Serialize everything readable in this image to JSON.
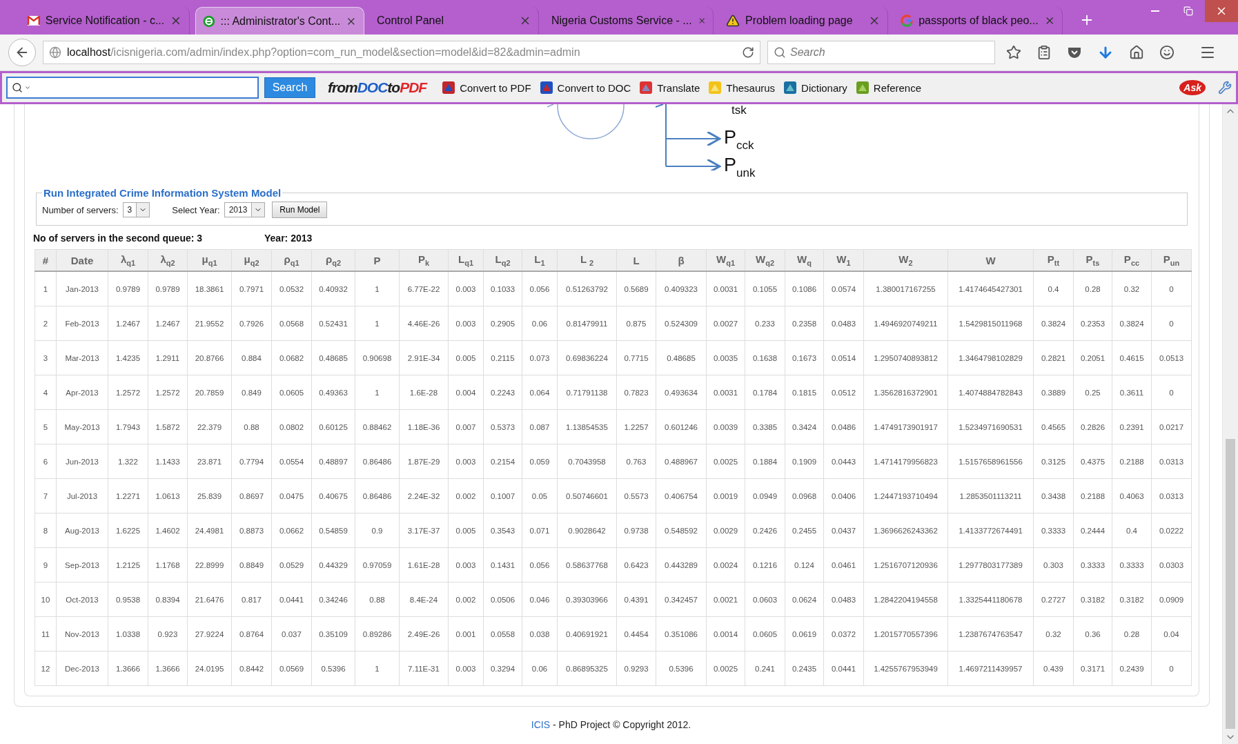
{
  "browser": {
    "tabs": [
      {
        "title": "Service Notification - c...",
        "selected": false
      },
      {
        "title": "::: Administrator's Cont...",
        "selected": true
      },
      {
        "title": "Control Panel",
        "selected": false
      },
      {
        "title": "Nigeria Customs Service - ...",
        "selected": false
      },
      {
        "title": "Problem loading page",
        "selected": false
      },
      {
        "title": "passports of black peo...",
        "selected": false
      }
    ],
    "url_host": "localhost",
    "url_path": "/icisnigeria.com/admin/index.php?option=com_run_model&section=model&id=82&admin=admin",
    "search_placeholder": "Search"
  },
  "toolbar": {
    "search_button": "Search",
    "logo": [
      "from",
      "DOC",
      "to",
      "PDF"
    ],
    "items": [
      "Convert to PDF",
      "Convert to DOC",
      "Translate",
      "Thesaurus",
      "Dictionary",
      "Reference"
    ],
    "ask_logo": "Ask"
  },
  "diagram": {
    "labels": [
      "$_{tsk}$",
      "P$_{cck}$",
      "P$_{unk}$"
    ]
  },
  "model_form": {
    "legend": "Run Integrated Crime Information System Model",
    "servers_label": "Number of servers:",
    "servers_value": "3",
    "year_label": "Select Year:",
    "year_value": "2013",
    "run_button": "Run Model"
  },
  "summary": {
    "servers_text": "No of servers in the second queue: 3",
    "year_text": "Year: 2013"
  },
  "table": {
    "columns": [
      "#",
      "Date",
      "λ$_{q1}$",
      "λ$_{q2}$",
      "μ$_{q1}$",
      "μ$_{q2}$",
      "ρ$_{q1}$",
      "ρ$_{q2}$",
      "P",
      "P$_{k}$",
      "L$_{q1}$",
      "L$_{q2}$",
      "L$_{1}$",
      "L $_{2}$",
      "L",
      "β",
      "W$_{q1}$",
      "W$_{q2}$",
      "W$_{q}$",
      "W$_{1}$",
      "W$_{2}$",
      "W",
      "P$_{tt}$",
      "P$_{ts}$",
      "P$_{cc}$",
      "P$_{un}$"
    ],
    "rows": [
      [
        "1",
        "Jan-2013",
        "0.9789",
        "0.9789",
        "18.3861",
        "0.7971",
        "0.0532",
        "0.40932",
        "1",
        "6.77E-22",
        "0.003",
        "0.1033",
        "0.056",
        "0.51263792",
        "0.5689",
        "0.409323",
        "0.0031",
        "0.1055",
        "0.1086",
        "0.0574",
        "1.380017167255",
        "1.4174645427301",
        "0.4",
        "0.28",
        "0.32",
        "0"
      ],
      [
        "2",
        "Feb-2013",
        "1.2467",
        "1.2467",
        "21.9552",
        "0.7926",
        "0.0568",
        "0.52431",
        "1",
        "4.46E-26",
        "0.003",
        "0.2905",
        "0.06",
        "0.81479911",
        "0.875",
        "0.524309",
        "0.0027",
        "0.233",
        "0.2358",
        "0.0483",
        "1.4946920749211",
        "1.5429815011968",
        "0.3824",
        "0.2353",
        "0.3824",
        "0"
      ],
      [
        "3",
        "Mar-2013",
        "1.4235",
        "1.2911",
        "20.8766",
        "0.884",
        "0.0682",
        "0.48685",
        "0.90698",
        "2.91E-34",
        "0.005",
        "0.2115",
        "0.073",
        "0.69836224",
        "0.7715",
        "0.48685",
        "0.0035",
        "0.1638",
        "0.1673",
        "0.0514",
        "1.2950740893812",
        "1.3464798102829",
        "0.2821",
        "0.2051",
        "0.4615",
        "0.0513"
      ],
      [
        "4",
        "Apr-2013",
        "1.2572",
        "1.2572",
        "20.7859",
        "0.849",
        "0.0605",
        "0.49363",
        "1",
        "1.6E-28",
        "0.004",
        "0.2243",
        "0.064",
        "0.71791138",
        "0.7823",
        "0.493634",
        "0.0031",
        "0.1784",
        "0.1815",
        "0.0512",
        "1.3562816372901",
        "1.4074884782843",
        "0.3889",
        "0.25",
        "0.3611",
        "0"
      ],
      [
        "5",
        "May-2013",
        "1.7943",
        "1.5872",
        "22.379",
        "0.88",
        "0.0802",
        "0.60125",
        "0.88462",
        "1.18E-36",
        "0.007",
        "0.5373",
        "0.087",
        "1.13854535",
        "1.2257",
        "0.601246",
        "0.0039",
        "0.3385",
        "0.3424",
        "0.0486",
        "1.4749173901917",
        "1.5234971690531",
        "0.4565",
        "0.2826",
        "0.2391",
        "0.0217"
      ],
      [
        "6",
        "Jun-2013",
        "1.322",
        "1.1433",
        "23.871",
        "0.7794",
        "0.0554",
        "0.48897",
        "0.86486",
        "1.87E-29",
        "0.003",
        "0.2154",
        "0.059",
        "0.7043958",
        "0.763",
        "0.488967",
        "0.0025",
        "0.1884",
        "0.1909",
        "0.0443",
        "1.4714179956823",
        "1.5157658961556",
        "0.3125",
        "0.4375",
        "0.2188",
        "0.0313"
      ],
      [
        "7",
        "Jul-2013",
        "1.2271",
        "1.0613",
        "25.839",
        "0.8697",
        "0.0475",
        "0.40675",
        "0.86486",
        "2.24E-32",
        "0.002",
        "0.1007",
        "0.05",
        "0.50746601",
        "0.5573",
        "0.406754",
        "0.0019",
        "0.0949",
        "0.0968",
        "0.0406",
        "1.2447193710494",
        "1.2853501113211",
        "0.3438",
        "0.2188",
        "0.4063",
        "0.0313"
      ],
      [
        "8",
        "Aug-2013",
        "1.6225",
        "1.4602",
        "24.4981",
        "0.8873",
        "0.0662",
        "0.54859",
        "0.9",
        "3.17E-37",
        "0.005",
        "0.3543",
        "0.071",
        "0.9028642",
        "0.9738",
        "0.548592",
        "0.0029",
        "0.2426",
        "0.2455",
        "0.0437",
        "1.3696626243362",
        "1.4133772674491",
        "0.3333",
        "0.2444",
        "0.4",
        "0.0222"
      ],
      [
        "9",
        "Sep-2013",
        "1.2125",
        "1.1768",
        "22.8999",
        "0.8849",
        "0.0529",
        "0.44329",
        "0.97059",
        "1.61E-28",
        "0.003",
        "0.1431",
        "0.056",
        "0.58637768",
        "0.6423",
        "0.443289",
        "0.0024",
        "0.1216",
        "0.124",
        "0.0461",
        "1.2516707120936",
        "1.2977803177389",
        "0.303",
        "0.3333",
        "0.3333",
        "0.0303"
      ],
      [
        "10",
        "Oct-2013",
        "0.9538",
        "0.8394",
        "21.6476",
        "0.817",
        "0.0441",
        "0.34246",
        "0.88",
        "8.4E-24",
        "0.002",
        "0.0506",
        "0.046",
        "0.39303966",
        "0.4391",
        "0.342457",
        "0.0021",
        "0.0603",
        "0.0624",
        "0.0483",
        "1.2842204194558",
        "1.3325441180678",
        "0.2727",
        "0.3182",
        "0.3182",
        "0.0909"
      ],
      [
        "11",
        "Nov-2013",
        "1.0338",
        "0.923",
        "27.9224",
        "0.8764",
        "0.037",
        "0.35109",
        "0.89286",
        "2.49E-26",
        "0.001",
        "0.0558",
        "0.038",
        "0.40691921",
        "0.4454",
        "0.351086",
        "0.0014",
        "0.0605",
        "0.0619",
        "0.0372",
        "1.2015770557396",
        "1.2387674763547",
        "0.32",
        "0.36",
        "0.28",
        "0.04"
      ],
      [
        "12",
        "Dec-2013",
        "1.3666",
        "1.3666",
        "24.0195",
        "0.8442",
        "0.0569",
        "0.5396",
        "1",
        "7.11E-31",
        "0.003",
        "0.3294",
        "0.06",
        "0.86895325",
        "0.9293",
        "0.5396",
        "0.0025",
        "0.241",
        "0.2435",
        "0.0441",
        "1.4255767953949",
        "1.4697211439957",
        "0.439",
        "0.3171",
        "0.2439",
        "0"
      ]
    ]
  },
  "footer": {
    "link": "ICIS",
    "text": "- PhD Project © Copyright 2012."
  }
}
